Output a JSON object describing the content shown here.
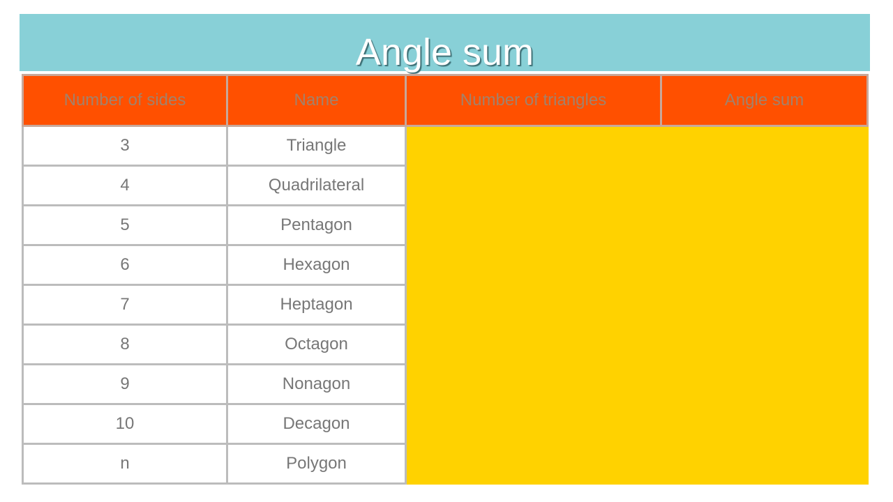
{
  "title": "Angle sum",
  "table": {
    "headers": [
      "Number of sides",
      "Name",
      "Number of triangles",
      "Angle sum"
    ],
    "rows": [
      {
        "sides": "3",
        "name": "Triangle",
        "triangles": "",
        "angle_sum": ""
      },
      {
        "sides": "4",
        "name": "Quadrilateral",
        "triangles": "",
        "angle_sum": ""
      },
      {
        "sides": "5",
        "name": "Pentagon",
        "triangles": "",
        "angle_sum": ""
      },
      {
        "sides": "6",
        "name": "Hexagon",
        "triangles": "",
        "angle_sum": ""
      },
      {
        "sides": "7",
        "name": "Heptagon",
        "triangles": "",
        "angle_sum": ""
      },
      {
        "sides": "8",
        "name": "Octagon",
        "triangles": "",
        "angle_sum": ""
      },
      {
        "sides": "9",
        "name": "Nonagon",
        "triangles": "",
        "angle_sum": ""
      },
      {
        "sides": "10",
        "name": "Decagon",
        "triangles": "",
        "angle_sum": ""
      },
      {
        "sides": "n",
        "name": "Polygon",
        "triangles": "",
        "angle_sum": ""
      }
    ]
  },
  "colors": {
    "title_bg": "#88d0d7",
    "header_bg": "#ff5000",
    "cover": "#ffd200"
  }
}
